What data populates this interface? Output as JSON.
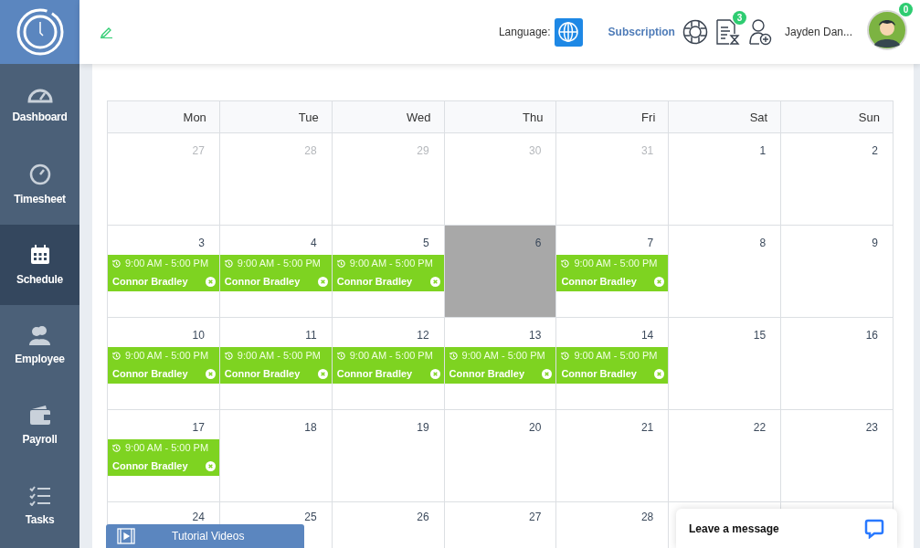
{
  "header": {
    "language_label": "Language:",
    "subscription": "Subscription",
    "tasks_badge": "3",
    "user_name": "Jayden Dan...",
    "avatar_badge": "0"
  },
  "sidebar": {
    "items": [
      {
        "label": "Dashboard",
        "selected": false
      },
      {
        "label": "Timesheet",
        "selected": false
      },
      {
        "label": "Schedule",
        "selected": true
      },
      {
        "label": "Employee",
        "selected": false
      },
      {
        "label": "Payroll",
        "selected": false
      },
      {
        "label": "Tasks",
        "selected": false
      }
    ]
  },
  "calendar": {
    "weekdays": [
      "Mon",
      "Tue",
      "Wed",
      "Thu",
      "Fri",
      "Sat",
      "Sun"
    ],
    "weeks": [
      {
        "days": [
          {
            "label": "27",
            "muted": true,
            "highlighted": false
          },
          {
            "label": "28",
            "muted": true,
            "highlighted": false
          },
          {
            "label": "29",
            "muted": true,
            "highlighted": false
          },
          {
            "label": "30",
            "muted": true,
            "highlighted": false
          },
          {
            "label": "31",
            "muted": true,
            "highlighted": false
          },
          {
            "label": "1",
            "muted": false,
            "highlighted": false
          },
          {
            "label": "2",
            "muted": false,
            "highlighted": false
          }
        ]
      },
      {
        "days": [
          {
            "label": "3",
            "muted": false,
            "highlighted": false,
            "events": [
              {
                "time": "9:00 AM - 5:00 PM",
                "name": "Connor Bradley"
              }
            ]
          },
          {
            "label": "4",
            "muted": false,
            "highlighted": false,
            "events": [
              {
                "time": "9:00 AM - 5:00 PM",
                "name": "Connor Bradley"
              }
            ]
          },
          {
            "label": "5",
            "muted": false,
            "highlighted": false,
            "events": [
              {
                "time": "9:00 AM - 5:00 PM",
                "name": "Connor Bradley"
              }
            ]
          },
          {
            "label": "6",
            "muted": false,
            "highlighted": true
          },
          {
            "label": "7",
            "muted": false,
            "highlighted": false,
            "events": [
              {
                "time": "9:00 AM - 5:00 PM",
                "name": "Connor Bradley"
              }
            ]
          },
          {
            "label": "8",
            "muted": false,
            "highlighted": false
          },
          {
            "label": "9",
            "muted": false,
            "highlighted": false
          }
        ]
      },
      {
        "days": [
          {
            "label": "10",
            "muted": false,
            "highlighted": false,
            "events": [
              {
                "time": "9:00 AM - 5:00 PM",
                "name": "Connor Bradley"
              }
            ]
          },
          {
            "label": "11",
            "muted": false,
            "highlighted": false,
            "events": [
              {
                "time": "9:00 AM - 5:00 PM",
                "name": "Connor Bradley"
              }
            ]
          },
          {
            "label": "12",
            "muted": false,
            "highlighted": false,
            "events": [
              {
                "time": "9:00 AM - 5:00 PM",
                "name": "Connor Bradley"
              }
            ]
          },
          {
            "label": "13",
            "muted": false,
            "highlighted": false,
            "events": [
              {
                "time": "9:00 AM - 5:00 PM",
                "name": "Connor Bradley"
              }
            ]
          },
          {
            "label": "14",
            "muted": false,
            "highlighted": false,
            "events": [
              {
                "time": "9:00 AM - 5:00 PM",
                "name": "Connor Bradley"
              }
            ]
          },
          {
            "label": "15",
            "muted": false,
            "highlighted": false
          },
          {
            "label": "16",
            "muted": false,
            "highlighted": false
          }
        ]
      },
      {
        "days": [
          {
            "label": "17",
            "muted": false,
            "highlighted": false,
            "events": [
              {
                "time": "9:00 AM - 5:00 PM",
                "name": "Connor Bradley"
              }
            ]
          },
          {
            "label": "18",
            "muted": false,
            "highlighted": false
          },
          {
            "label": "19",
            "muted": false,
            "highlighted": false
          },
          {
            "label": "20",
            "muted": false,
            "highlighted": false
          },
          {
            "label": "21",
            "muted": false,
            "highlighted": false
          },
          {
            "label": "22",
            "muted": false,
            "highlighted": false
          },
          {
            "label": "23",
            "muted": false,
            "highlighted": false
          }
        ]
      },
      {
        "days": [
          {
            "label": "24",
            "muted": false,
            "highlighted": false
          },
          {
            "label": "25",
            "muted": false,
            "highlighted": false
          },
          {
            "label": "26",
            "muted": false,
            "highlighted": false
          },
          {
            "label": "27",
            "muted": false,
            "highlighted": false
          },
          {
            "label": "28",
            "muted": false,
            "highlighted": false
          }
        ]
      }
    ]
  },
  "tutorial_bar": {
    "label": "Tutorial Videos"
  },
  "chat_widget": {
    "label": "Leave a message"
  }
}
